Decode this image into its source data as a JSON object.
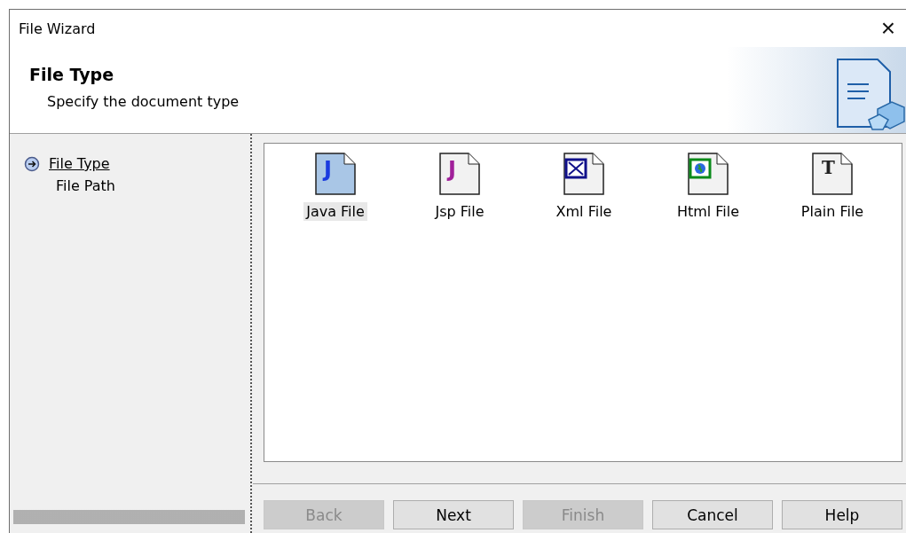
{
  "window": {
    "title": "File Wizard",
    "close": "×"
  },
  "header": {
    "title": "File Type",
    "subtitle": "Specify the document type"
  },
  "steps": [
    {
      "label": "File Type",
      "selected": true
    },
    {
      "label": "File Path",
      "selected": false
    }
  ],
  "file_types": [
    {
      "label": "Java File",
      "kind": "java",
      "glyph": "J",
      "selected": true
    },
    {
      "label": "Jsp File",
      "kind": "jsp",
      "glyph": "J",
      "selected": false
    },
    {
      "label": "Xml File",
      "kind": "xml",
      "selected": false
    },
    {
      "label": "Html File",
      "kind": "html",
      "selected": false
    },
    {
      "label": "Plain File",
      "kind": "plain",
      "glyph": "T",
      "selected": false
    }
  ],
  "buttons": [
    {
      "label": "Back",
      "disabled": true
    },
    {
      "label": "Next",
      "disabled": false
    },
    {
      "label": "Finish",
      "disabled": true
    },
    {
      "label": "Cancel",
      "disabled": false
    },
    {
      "label": "Help",
      "disabled": false
    }
  ]
}
